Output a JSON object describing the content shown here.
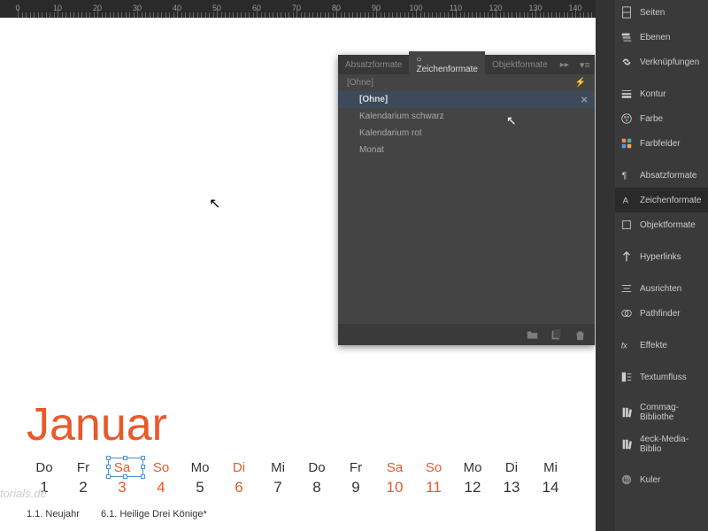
{
  "ruler_numbers": [
    0,
    10,
    20,
    30,
    40,
    50,
    60,
    70,
    80,
    90,
    100,
    110,
    120,
    130,
    140
  ],
  "month": "Januar",
  "calendar": {
    "days": [
      {
        "name": "Do",
        "num": "1",
        "weekend": false
      },
      {
        "name": "Fr",
        "num": "2",
        "weekend": false
      },
      {
        "name": "Sa",
        "num": "3",
        "weekend": true
      },
      {
        "name": "So",
        "num": "4",
        "weekend": true
      },
      {
        "name": "Mo",
        "num": "5",
        "weekend": false
      },
      {
        "name": "Di",
        "num": "6",
        "weekend": true
      },
      {
        "name": "Mi",
        "num": "7",
        "weekend": false
      },
      {
        "name": "Do",
        "num": "8",
        "weekend": false
      },
      {
        "name": "Fr",
        "num": "9",
        "weekend": false
      },
      {
        "name": "Sa",
        "num": "10",
        "weekend": true
      },
      {
        "name": "So",
        "num": "11",
        "weekend": true
      },
      {
        "name": "Mo",
        "num": "12",
        "weekend": false
      },
      {
        "name": "Di",
        "num": "13",
        "weekend": false
      },
      {
        "name": "Mi",
        "num": "14",
        "weekend": false
      }
    ]
  },
  "holidays": [
    "1.1. Neujahr",
    "6.1. Heilige Drei Könige*"
  ],
  "watermark": "torials.de",
  "floating_panel": {
    "tabs": [
      "Absatzformate",
      "Zeichenformate",
      "Objektformate"
    ],
    "active_tab": 1,
    "context": "[Ohne]",
    "lightning": "⚡",
    "items": [
      {
        "label": "[Ohne]",
        "selected": true
      },
      {
        "label": "Kalendarium schwarz",
        "selected": false
      },
      {
        "label": "Kalendarium rot",
        "selected": false
      },
      {
        "label": "Monat",
        "selected": false
      }
    ]
  },
  "right_panels": [
    {
      "icon": "pages",
      "label": "Seiten"
    },
    {
      "icon": "layers",
      "label": "Ebenen"
    },
    {
      "icon": "links",
      "label": "Verknüpfungen"
    },
    {
      "sep": true
    },
    {
      "icon": "stroke",
      "label": "Kontur"
    },
    {
      "icon": "palette",
      "label": "Farbe"
    },
    {
      "icon": "swatches",
      "label": "Farbfelder"
    },
    {
      "sep": true
    },
    {
      "icon": "para",
      "label": "Absatzformate"
    },
    {
      "icon": "char",
      "label": "Zeichenformate",
      "active": true
    },
    {
      "icon": "obj",
      "label": "Objektformate"
    },
    {
      "sep": true
    },
    {
      "icon": "hyperlink",
      "label": "Hyperlinks"
    },
    {
      "sep": true
    },
    {
      "icon": "align",
      "label": "Ausrichten"
    },
    {
      "icon": "pathfinder",
      "label": "Pathfinder"
    },
    {
      "sep": true
    },
    {
      "icon": "fx",
      "label": "Effekte"
    },
    {
      "sep": true
    },
    {
      "icon": "wrap",
      "label": "Textumfluss"
    },
    {
      "sep": true
    },
    {
      "icon": "lib1",
      "label": "Commag-Bibliothe"
    },
    {
      "icon": "lib2",
      "label": "4eck-Media-Biblio"
    },
    {
      "sep": true
    },
    {
      "icon": "kuler",
      "label": "Kuler"
    }
  ]
}
